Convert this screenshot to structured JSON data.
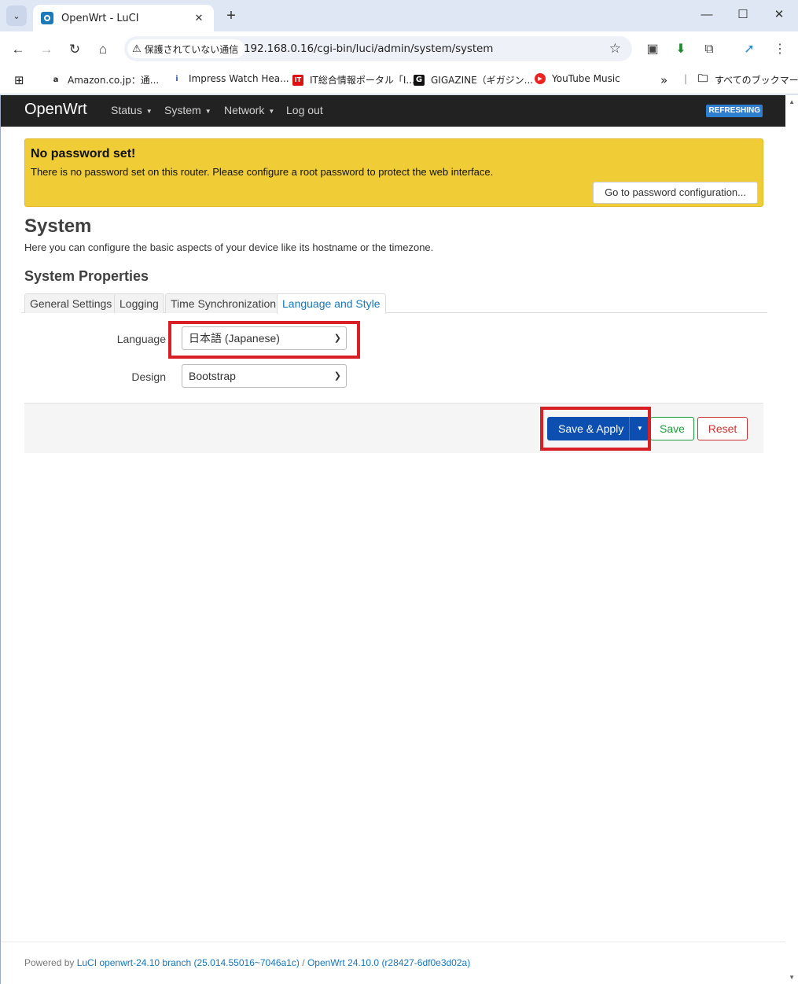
{
  "browser": {
    "tab_title": "OpenWrt - LuCI",
    "tab_close": "✕",
    "new_tab": "+",
    "security_label": "保護されていない通信",
    "url": "192.168.0.16/cgi-bin/luci/admin/system/system",
    "bookmarks": [
      {
        "label": "Amazon.co.jp：通...",
        "icon": "amazon-icon",
        "glyph": "a",
        "color": "#222"
      },
      {
        "label": "Impress Watch Hea...",
        "icon": "impress-icon",
        "glyph": "i",
        "color": "#3b5fa8"
      },
      {
        "label": "IT総合情報ポータル「I...",
        "icon": "itmedia-icon",
        "glyph": "IT",
        "color": "#d11"
      },
      {
        "label": "GIGAZINE（ギガジン...",
        "icon": "gigazine-icon",
        "glyph": "G",
        "color": "#111"
      },
      {
        "label": "YouTube Music",
        "icon": "youtube-music-icon",
        "glyph": "▶",
        "color": "#e22"
      }
    ],
    "bookmarks_overflow": "»",
    "all_bookmarks": "すべてのブックマーク"
  },
  "luci": {
    "brand": "OpenWrt",
    "menu": [
      "Status",
      "System",
      "Network",
      "Log out"
    ],
    "badge": "REFRESHING",
    "alert_title": "No password set!",
    "alert_text": "There is no password set on this router. Please configure a root password to protect the web interface.",
    "alert_button": "Go to password configuration...",
    "page_title": "System",
    "page_desc": "Here you can configure the basic aspects of your device like its hostname or the timezone.",
    "section_title": "System Properties",
    "tabs": [
      "General Settings",
      "Logging",
      "Time Synchronization",
      "Language and Style"
    ],
    "language_label": "Language",
    "language_value": "日本語 (Japanese)",
    "design_label": "Design",
    "design_value": "Bootstrap",
    "save_apply": "Save & Apply",
    "save": "Save",
    "reset": "Reset",
    "footer_prefix": "Powered by ",
    "footer_luci": "LuCI openwrt-24.10 branch (25.014.55016~7046a1c)",
    "footer_sep": " / ",
    "footer_openwrt": "OpenWrt 24.10.0 (r28427-6df0e3d02a)"
  },
  "colors": {
    "highlight": "#d81f26",
    "accent": "#0d4fb0",
    "alert": "#f0cd37"
  }
}
